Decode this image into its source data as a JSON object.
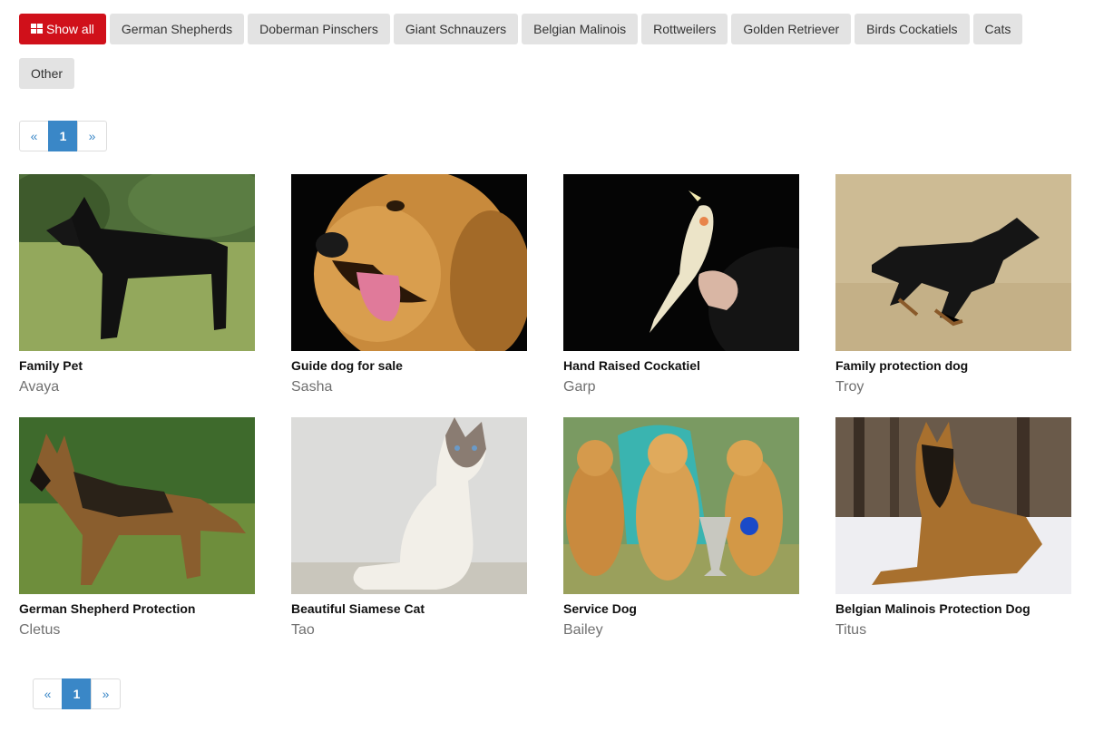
{
  "filters": [
    {
      "label": "Show all",
      "active": true,
      "icon": "grid-icon"
    },
    {
      "label": "German Shepherds"
    },
    {
      "label": "Doberman Pinschers"
    },
    {
      "label": "Giant Schnauzers"
    },
    {
      "label": "Belgian Malinois"
    },
    {
      "label": "Rottweilers"
    },
    {
      "label": "Golden Retriever"
    },
    {
      "label": "Birds Cockatiels"
    },
    {
      "label": "Cats"
    },
    {
      "label": "Other"
    }
  ],
  "pagination": {
    "prev": "«",
    "current": "1",
    "next": "»"
  },
  "listings": [
    {
      "title": "Family Pet",
      "name": "Avaya"
    },
    {
      "title": "Guide dog for sale",
      "name": "Sasha"
    },
    {
      "title": "Hand Raised Cockatiel",
      "name": "Garp"
    },
    {
      "title": "Family protection dog",
      "name": "Troy"
    },
    {
      "title": "German Shepherd Protection",
      "name": "Cletus"
    },
    {
      "title": "Beautiful Siamese Cat",
      "name": "Tao"
    },
    {
      "title": "Service Dog",
      "name": "Bailey"
    },
    {
      "title": "Belgian Malinois Protection Dog",
      "name": "Titus"
    }
  ],
  "colors": {
    "accent": "#d0101a",
    "pager": "#3a87c7",
    "button_bg": "#e3e3e3"
  }
}
